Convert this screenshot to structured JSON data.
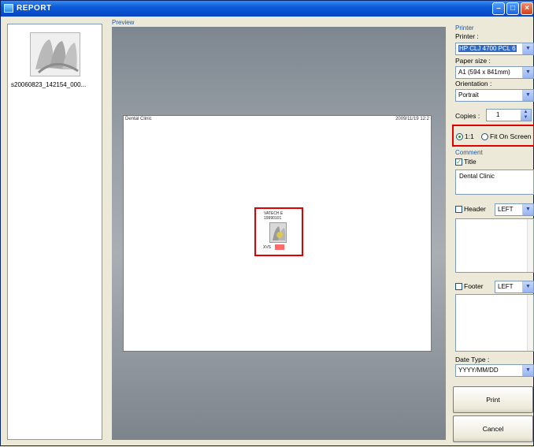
{
  "window": {
    "title": "REPORT"
  },
  "thumbnails": {
    "items": [
      {
        "caption": "s20060823_142154_000..."
      }
    ]
  },
  "preview": {
    "label": "Preview",
    "page": {
      "clinic": "Dental Clinic",
      "date": "2009/11/19  12:2",
      "item_line1": "VATECH E",
      "item_line2": "19990101",
      "item_footer": "XVS"
    }
  },
  "printer": {
    "section_label": "Printer",
    "printer_label": "Printer :",
    "printer_value": "HP CLJ 4700 PCL 6",
    "paper_label": "Paper size :",
    "paper_value": "A1 (594 x 841mm)",
    "orientation_label": "Orientation :",
    "orientation_value": "Portrait",
    "copies_label": "Copies :",
    "copies_value": "1"
  },
  "scale": {
    "one_to_one": "1:1",
    "fit_on_screen": "Fit On Screen",
    "selected": "1:1"
  },
  "comment": {
    "section_label": "Comment",
    "title_label": "Title",
    "title_checked": true,
    "title_text": "Dental Clinic",
    "header_label": "Header",
    "header_align": "LEFT",
    "footer_label": "Footer",
    "footer_align": "LEFT"
  },
  "date": {
    "label": "Date Type :",
    "value": "YYYY/MM/DD"
  },
  "buttons": {
    "print": "Print",
    "cancel": "Cancel"
  }
}
